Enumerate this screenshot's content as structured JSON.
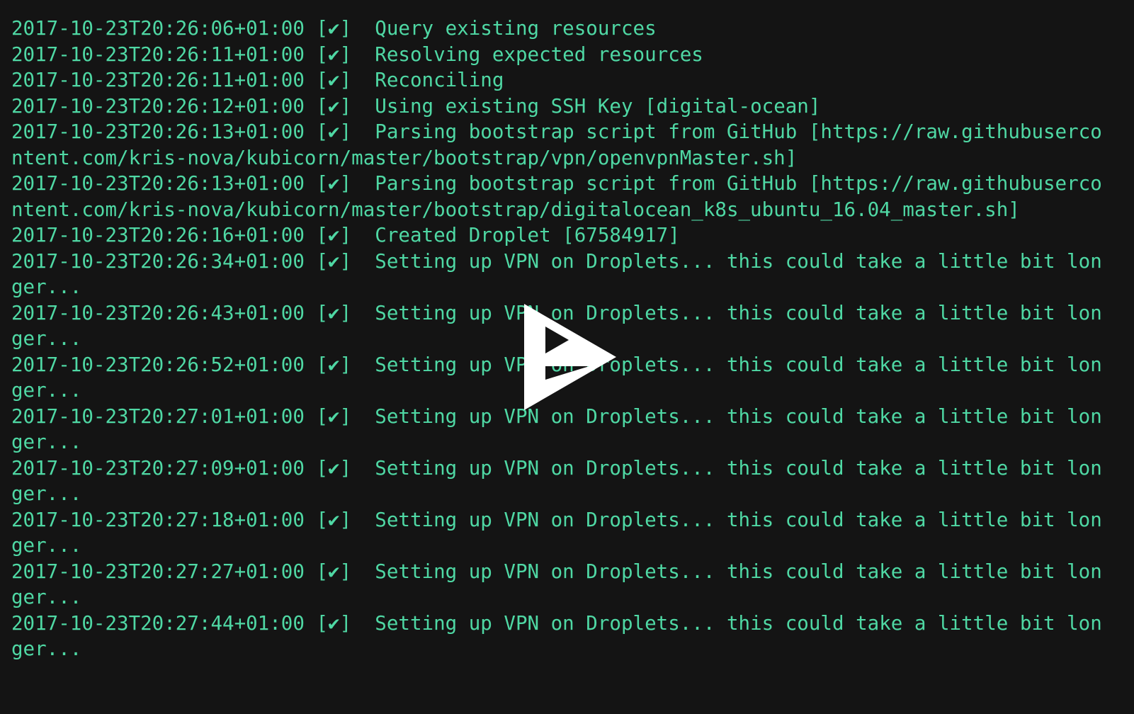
{
  "player": {
    "background_color": "#141414",
    "text_color": "#4fd8a4",
    "overlay_color": "#ffffff",
    "play_button_label": "Play",
    "play_icon_name": "asciinema-play-icon",
    "columns": 93,
    "rows": 27
  },
  "terminal": {
    "lines": [
      {
        "ts": "2017-10-23T20:26:06+01:00",
        "mark": "[✔]",
        "msg": "Query existing resources"
      },
      {
        "ts": "2017-10-23T20:26:11+01:00",
        "mark": "[✔]",
        "msg": "Resolving expected resources"
      },
      {
        "ts": "2017-10-23T20:26:11+01:00",
        "mark": "[✔]",
        "msg": "Reconciling"
      },
      {
        "ts": "2017-10-23T20:26:12+01:00",
        "mark": "[✔]",
        "msg": "Using existing SSH Key [digital-ocean]"
      },
      {
        "ts": "2017-10-23T20:26:13+01:00",
        "mark": "[✔]",
        "msg": "Parsing bootstrap script from GitHub [https://raw.githubuserco"
      },
      {
        "ts": "",
        "mark": "",
        "msg": "ntent.com/kris-nova/kubicorn/master/bootstrap/vpn/openvpnMaster.sh]"
      },
      {
        "ts": "2017-10-23T20:26:13+01:00",
        "mark": "[✔]",
        "msg": "Parsing bootstrap script from GitHub [https://raw.githubuserco"
      },
      {
        "ts": "",
        "mark": "",
        "msg": "ntent.com/kris-nova/kubicorn/master/bootstrap/digitalocean_k8s_ubuntu_16.04_master.sh]"
      },
      {
        "ts": "2017-10-23T20:26:16+01:00",
        "mark": "[✔]",
        "msg": "Created Droplet [67584917]"
      },
      {
        "ts": "2017-10-23T20:26:34+01:00",
        "mark": "[✔]",
        "msg": "Setting up VPN on Droplets... this could take a little bit lon"
      },
      {
        "ts": "",
        "mark": "",
        "msg": "ger..."
      },
      {
        "ts": "2017-10-23T20:26:43+01:00",
        "mark": "[✔]",
        "msg": "Setting up VPN on Droplets... this could take a little bit lon"
      },
      {
        "ts": "",
        "mark": "",
        "msg": "ger..."
      },
      {
        "ts": "2017-10-23T20:26:52+01:00",
        "mark": "[✔]",
        "msg": "Setting up VPN on Droplets... this could take a little bit lon"
      },
      {
        "ts": "",
        "mark": "",
        "msg": "ger..."
      },
      {
        "ts": "2017-10-23T20:27:01+01:00",
        "mark": "[✔]",
        "msg": "Setting up VPN on Droplets... this could take a little bit lon"
      },
      {
        "ts": "",
        "mark": "",
        "msg": "ger..."
      },
      {
        "ts": "2017-10-23T20:27:09+01:00",
        "mark": "[✔]",
        "msg": "Setting up VPN on Droplets... this could take a little bit lon"
      },
      {
        "ts": "",
        "mark": "",
        "msg": "ger..."
      },
      {
        "ts": "2017-10-23T20:27:18+01:00",
        "mark": "[✔]",
        "msg": "Setting up VPN on Droplets... this could take a little bit lon"
      },
      {
        "ts": "",
        "mark": "",
        "msg": "ger..."
      },
      {
        "ts": "2017-10-23T20:27:27+01:00",
        "mark": "[✔]",
        "msg": "Setting up VPN on Droplets... this could take a little bit lon"
      },
      {
        "ts": "",
        "mark": "",
        "msg": "ger..."
      },
      {
        "ts": "2017-10-23T20:27:44+01:00",
        "mark": "[✔]",
        "msg": "Setting up VPN on Droplets... this could take a little bit lon"
      },
      {
        "ts": "",
        "mark": "",
        "msg": "ger..."
      },
      {
        "ts": "",
        "mark": "",
        "msg": ""
      },
      {
        "ts": "",
        "mark": "",
        "msg": ""
      }
    ]
  }
}
